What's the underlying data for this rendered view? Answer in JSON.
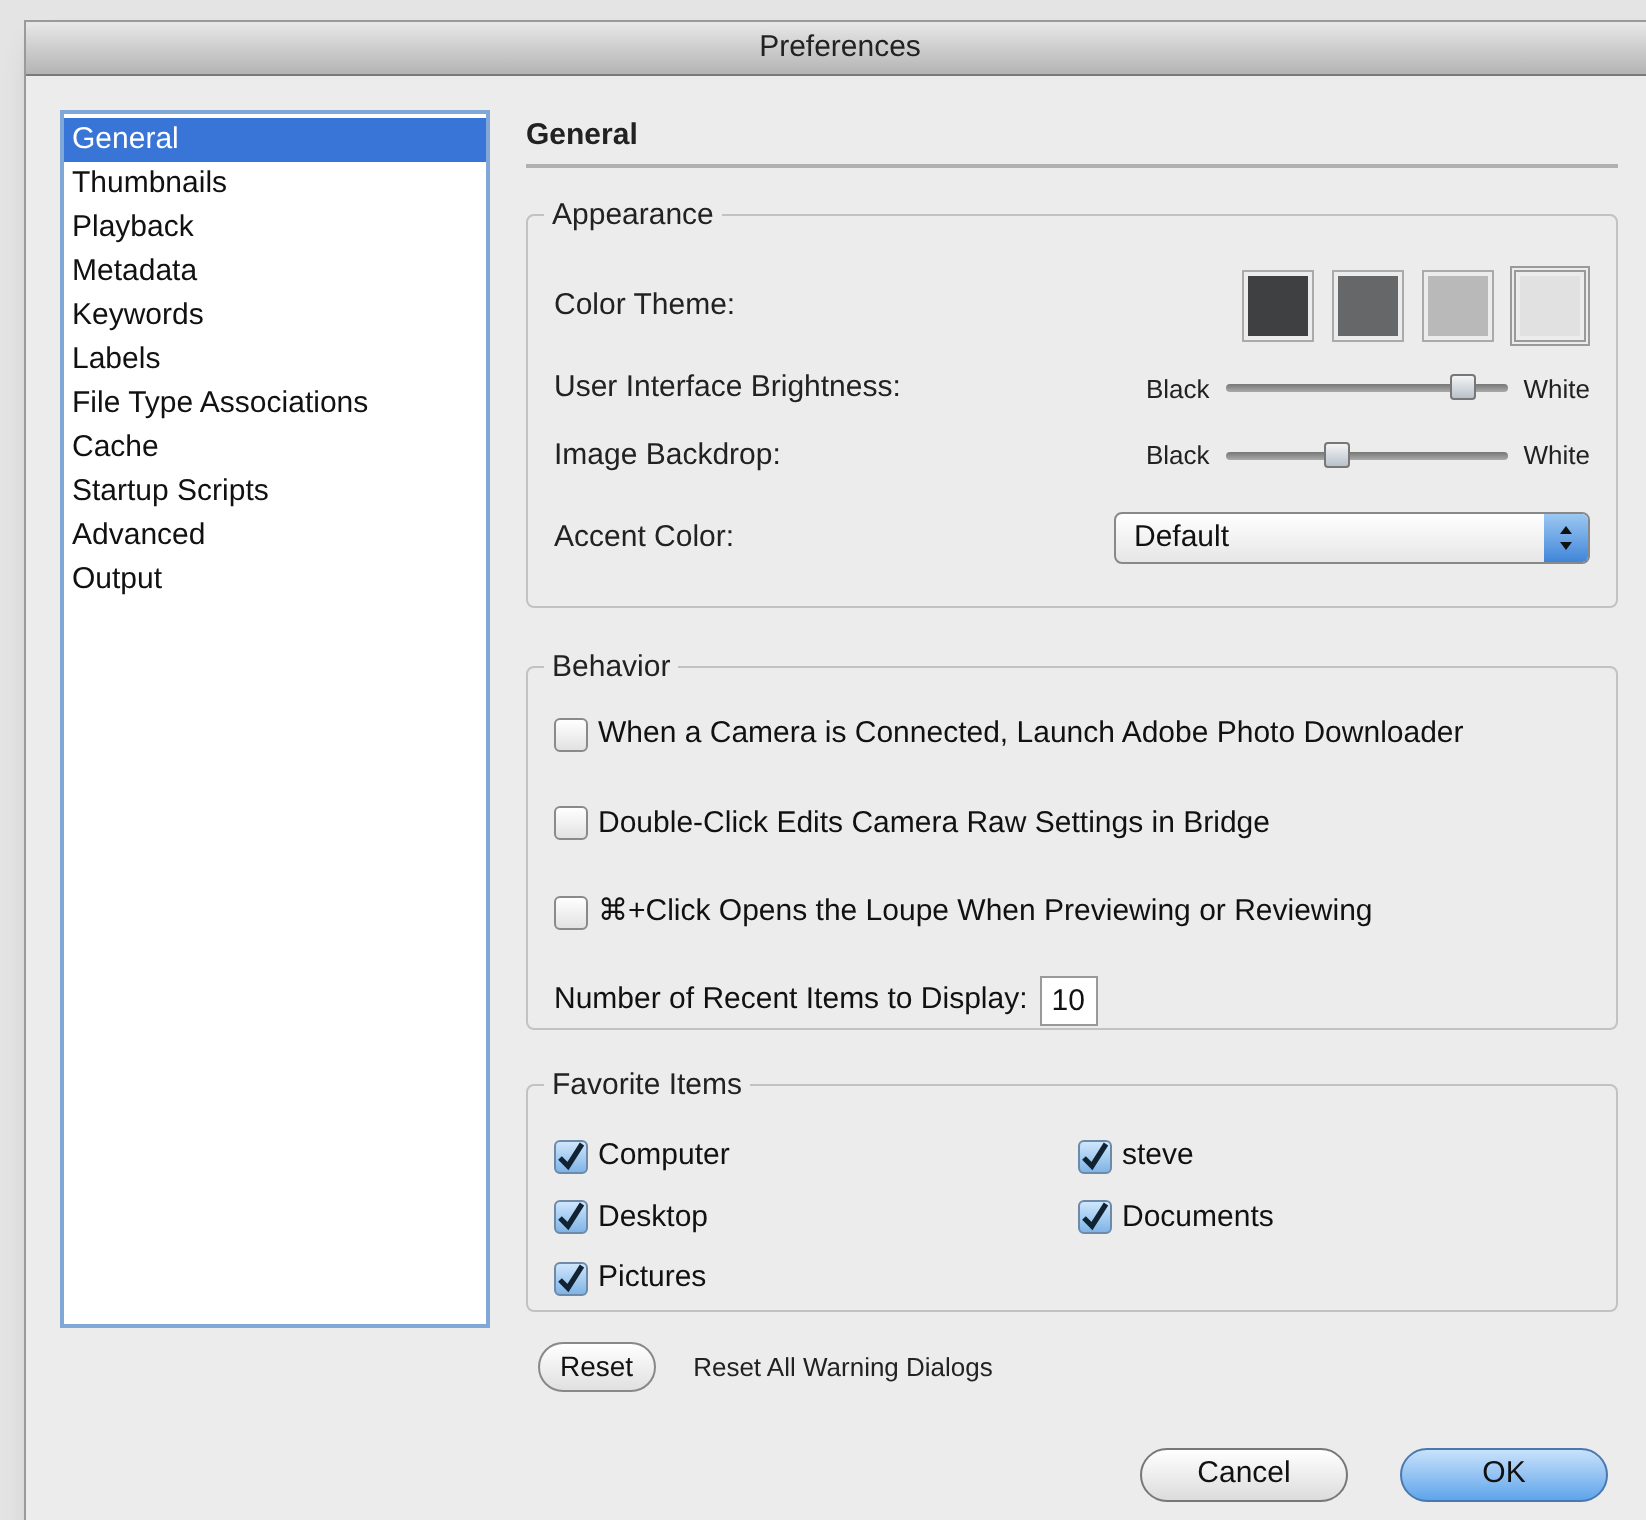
{
  "window": {
    "title": "Preferences"
  },
  "sidebar": {
    "items": [
      {
        "label": "General",
        "selected": true
      },
      {
        "label": "Thumbnails",
        "selected": false
      },
      {
        "label": "Playback",
        "selected": false
      },
      {
        "label": "Metadata",
        "selected": false
      },
      {
        "label": "Keywords",
        "selected": false
      },
      {
        "label": "Labels",
        "selected": false
      },
      {
        "label": "File Type Associations",
        "selected": false
      },
      {
        "label": "Cache",
        "selected": false
      },
      {
        "label": "Startup Scripts",
        "selected": false
      },
      {
        "label": "Advanced",
        "selected": false
      },
      {
        "label": "Output",
        "selected": false
      }
    ]
  },
  "page_title": "General",
  "appearance": {
    "title": "Appearance",
    "color_theme": {
      "label": "Color Theme:",
      "swatches": [
        {
          "color": "#3f4041",
          "selected": false
        },
        {
          "color": "#666768",
          "selected": false
        },
        {
          "color": "#b9b9ba",
          "selected": false
        },
        {
          "color": "#e1e1e1",
          "selected": true
        }
      ]
    },
    "sliders": [
      {
        "label": "User Interface Brightness:",
        "min_label": "Black",
        "max_label": "White",
        "level": 0.84
      },
      {
        "label": "Image Backdrop:",
        "min_label": "Black",
        "max_label": "White",
        "level": 0.39
      }
    ],
    "accent_color": {
      "label": "Accent Color:",
      "value": "Default"
    }
  },
  "behavior": {
    "title": "Behavior",
    "options": [
      {
        "label": "When a Camera is Connected, Launch Adobe Photo Downloader",
        "checked": false
      },
      {
        "label": "Double-Click Edits Camera Raw Settings in Bridge",
        "checked": false
      },
      {
        "label": "⌘+Click Opens the Loupe When Previewing or Reviewing",
        "checked": false
      }
    ],
    "recent_items": {
      "label": "Number of Recent Items to Display:",
      "value": "10"
    }
  },
  "favorite_items": {
    "title": "Favorite Items",
    "items": [
      {
        "label": "Computer",
        "checked": true
      },
      {
        "label": "steve",
        "checked": true
      },
      {
        "label": "Desktop",
        "checked": true
      },
      {
        "label": "Documents",
        "checked": true
      },
      {
        "label": "Pictures",
        "checked": true
      }
    ]
  },
  "reset": {
    "button": "Reset",
    "label": "Reset All Warning Dialogs"
  },
  "buttons": [
    {
      "label": "Cancel",
      "kind": "secondary"
    },
    {
      "label": "OK",
      "kind": "default"
    }
  ]
}
